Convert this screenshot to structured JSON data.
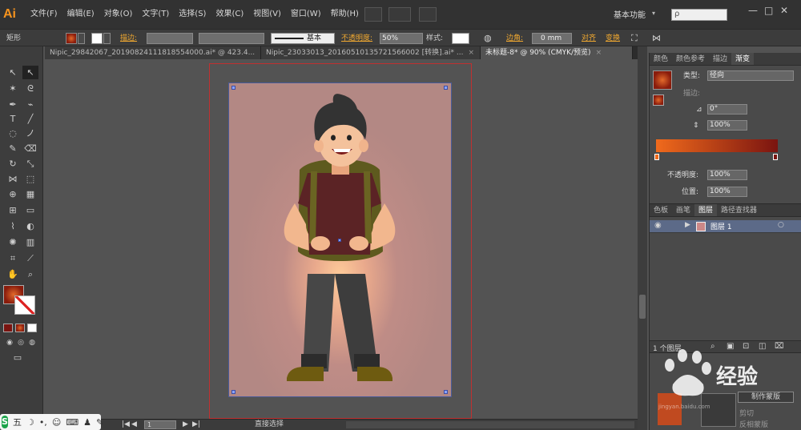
{
  "app": {
    "logo": "Ai"
  },
  "menubar": {
    "items": [
      "文件(F)",
      "编辑(E)",
      "对象(O)",
      "文字(T)",
      "选择(S)",
      "效果(C)",
      "视图(V)",
      "窗口(W)",
      "帮助(H)"
    ],
    "workspace": "基本功能",
    "search_placeholder": "ρ",
    "win_minimize": "—",
    "win_maximize": "□",
    "win_close": "✕"
  },
  "control": {
    "object_type": "矩形",
    "stroke_label": "描边:",
    "stroke_style": "基本",
    "opacity_label": "不透明度:",
    "opacity_value": "50%",
    "style_label": "样式:",
    "corner_label": "边角:",
    "corner_value": "0 mm",
    "align_label": "对齐",
    "transform_label": "变换"
  },
  "tabs": [
    {
      "label": "Nipic_29842067_20190824111818554000.ai* @ 423.4...",
      "close": "×"
    },
    {
      "label": "Nipic_23033013_20160510135721566002 [转换].ai* ...",
      "close": "×"
    },
    {
      "label": "未标题-8* @ 90% (CMYK/预览)",
      "close": "×"
    }
  ],
  "gradient_panel": {
    "tabs": [
      "颜色",
      "颜色参考",
      "描边",
      "渐变"
    ],
    "type_label": "类型:",
    "type_value": "径向",
    "stroke_label": "描边:",
    "angle_value": "0°",
    "aspect_value": "100%",
    "opacity_label": "不透明度:",
    "opacity_value": "100%",
    "location_label": "位置:",
    "location_value": "100%",
    "colors": {
      "start": "#f06a1c",
      "end": "#7a1410"
    }
  },
  "layers_panel": {
    "tabs": [
      "色板",
      "画笔",
      "图层",
      "路径查找器"
    ],
    "layer_name": "图层 1",
    "footer_count": "1 个图层"
  },
  "transparency_panel": {
    "make_mask": "制作蒙版",
    "clip": "剪切",
    "invert_mask": "反相蒙版"
  },
  "status": {
    "zoom": "90%",
    "page": "1",
    "tool": "直接选择"
  },
  "ime": {
    "logo": "S",
    "mode": "五"
  },
  "watermark": {
    "text": "经验",
    "sub": "jingyan.baidu.com"
  }
}
